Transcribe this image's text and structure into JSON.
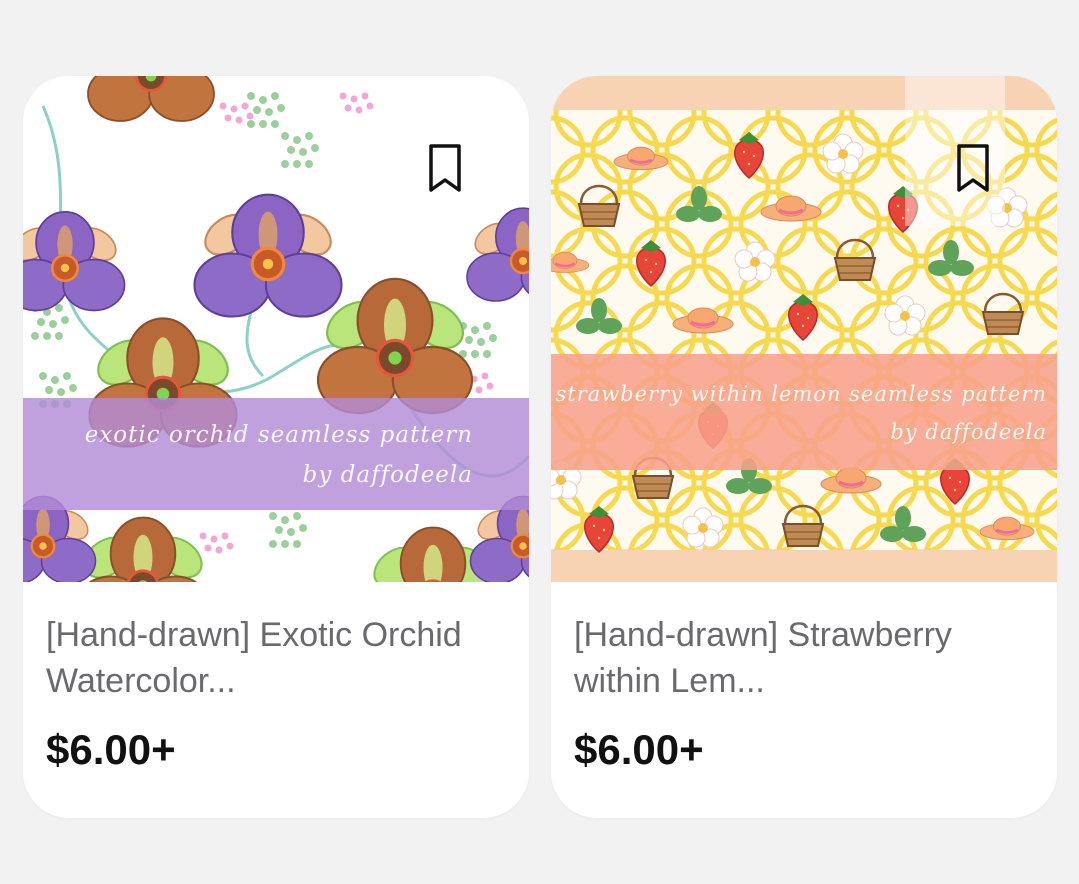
{
  "products": [
    {
      "image_line1": "exotic orchid seamless pattern",
      "image_line2": "by daffodeela",
      "title": "[Hand-drawn] Exotic Orchid Watercolor...",
      "price": "$6.00+",
      "banner_color": "#b28bd6",
      "icon": "bookmark-icon"
    },
    {
      "image_line1": "strawberry within lemon seamless pattern",
      "image_line2": "by daffodeela",
      "title": "[Hand-drawn] Strawberry within Lem...",
      "price": "$6.00+",
      "banner_color": "#f8a08a",
      "icon": "bookmark-icon"
    }
  ]
}
